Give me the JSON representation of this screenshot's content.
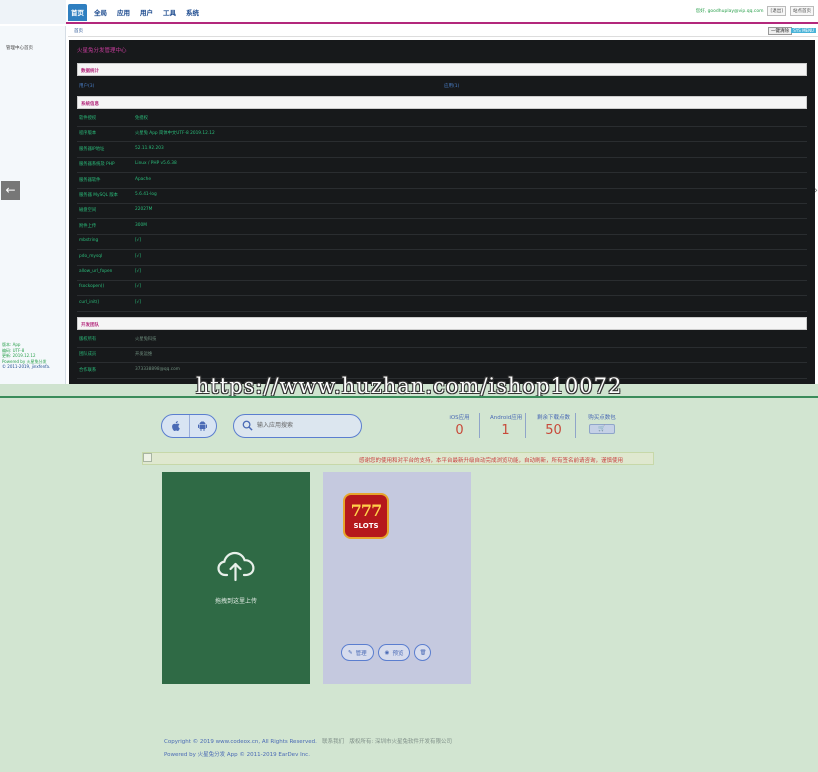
{
  "admin": {
    "nav": [
      "首页",
      "全局",
      "应用",
      "用户",
      "工具",
      "系统"
    ],
    "nav_active_index": 0,
    "user_label": "您好, goodhuplay@vip.qq.com",
    "logout": "[退出]",
    "site_home": "站点首页",
    "breadcrumb": "首页",
    "refresh": "一键清除",
    "tag": "SYS MENU",
    "sidebar_item": "管理中心首页",
    "sidebar_info": [
      "版本: App",
      "编码: UTF-8",
      "更新: 2019.12.12",
      "Powered by 火星兔分发",
      "© 2011-2019, jinxfenfa."
    ],
    "panel_title": "火星兔分发管理中心",
    "section_data": "数据统计",
    "stat_users": "用户(3)",
    "stat_apps": "应用(1)",
    "section_sys": "系统信息",
    "sys_rows": [
      {
        "k": "软件授权",
        "v": "免授权"
      },
      {
        "k": "程序版本",
        "v": "火星兔 App 简体中文UTF-8 2019.12.12"
      },
      {
        "k": "服务器IP地址",
        "v": "52.11.92.203"
      },
      {
        "k": "服务器系统及 PHP",
        "v": "Linux / PHP v5.6.38"
      },
      {
        "k": "服务器软件",
        "v": "Apache"
      },
      {
        "k": "服务器 MySQL 版本",
        "v": "5.6.41-log"
      },
      {
        "k": "磁盘空间",
        "v": "22027M"
      },
      {
        "k": "附件上传",
        "v": "300M"
      },
      {
        "k": "mbstring",
        "v": "[√]"
      },
      {
        "k": "pdo_mysql",
        "v": "[√]"
      },
      {
        "k": "allow_url_fopen",
        "v": "[√]"
      },
      {
        "k": "fsockopen()",
        "v": "[√]"
      },
      {
        "k": "curl_init()",
        "v": "[√]"
      }
    ],
    "section_team": "开发团队",
    "team_rows": [
      {
        "k": "版权所有",
        "v": "火星兔科技"
      },
      {
        "k": "团队成员",
        "v": "开发运维"
      },
      {
        "k": "合作联系",
        "v": "373338898@qq.com"
      }
    ]
  },
  "watermark": "https://www.huzhan.com/ishop10072",
  "app": {
    "search_placeholder": "输入应用搜索",
    "stats": [
      {
        "label": "iOS应用",
        "value": "0"
      },
      {
        "label": "Android应用",
        "value": "1"
      },
      {
        "label": "剩余下载点数",
        "value": "50"
      }
    ],
    "buy_label": "购买点数包",
    "notice": "感谢您的使用和对平台的支持，本平台最新升级自动完成浏览功能，自动刷新，所有签名前请咨询，谨慎使用",
    "upload_text": "拖拽到这里上传",
    "app_card": {
      "icon_big": "777",
      "icon_small": "SLOTS",
      "manage": "管理",
      "preview": "预览"
    },
    "footer": {
      "copyright": "Copyright © 2019 www.codeox.cn, All Rights Reserved.",
      "contact": "联系我们",
      "owner": "版权所有: 深圳市火星兔软件开发有限公司",
      "powered": "Powered by 火星兔分发 App © 2011-2019 EarDev Inc."
    }
  }
}
